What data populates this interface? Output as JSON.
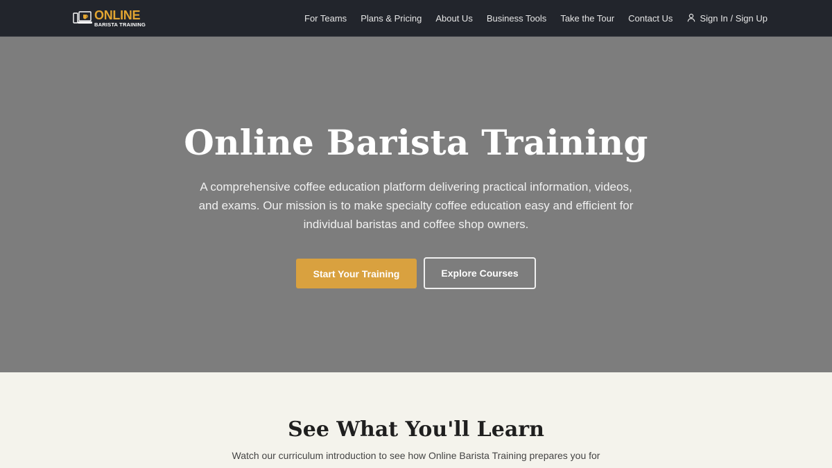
{
  "brand": {
    "name_main": "ONLINE",
    "name_sub": "BARISTA TRAINING",
    "accent_color": "#e2a531",
    "icon": "laptop-coffee-logo-icon"
  },
  "nav": {
    "items": [
      {
        "label": "For Teams"
      },
      {
        "label": "Plans & Pricing"
      },
      {
        "label": "About Us"
      },
      {
        "label": "Business Tools"
      },
      {
        "label": "Take the Tour"
      },
      {
        "label": "Contact Us"
      }
    ],
    "signin": {
      "label": "Sign In / Sign Up",
      "icon": "user-icon"
    }
  },
  "hero": {
    "title": "Online Barista Training",
    "description": "A comprehensive coffee education platform delivering practical information, videos, and exams. Our mission is to make specialty coffee education easy and efficient for individual baristas and coffee shop owners.",
    "primary_cta": "Start Your Training",
    "secondary_cta": "Explore Courses",
    "primary_color": "#d9a13f",
    "background_color": "#7d7d7d"
  },
  "learn": {
    "title": "See What You'll Learn",
    "description": "Watch our curriculum introduction to see how Online Barista Training prepares you for"
  }
}
